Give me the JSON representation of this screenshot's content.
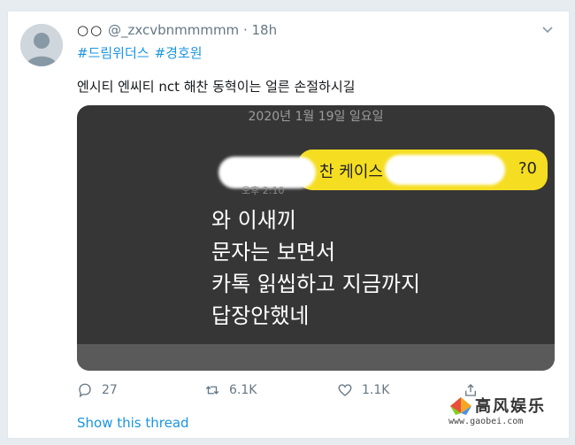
{
  "tweet": {
    "display_name": "○○",
    "handle": "@_zxcvbnmmmmm",
    "separator": "·",
    "time": "18h",
    "hashtags": [
      "#드림위더스",
      "#경호원"
    ],
    "text": "엔시티 엔씨티 nct 해찬 동혁이는 얼른 손절하시길"
  },
  "media": {
    "date_banner": "2020년 1월 19일 일요일",
    "outgoing_fragment_left": "찬 케이스",
    "outgoing_fragment_right": "?0",
    "time_fragment": "오후 2:10",
    "incoming_lines": [
      "와 이새끼",
      "문자는 보면서",
      "카톡 읽씹하고 지금까지",
      "답장안했네"
    ],
    "bubble_color": "#f5de21"
  },
  "actions": {
    "reply_count": "27",
    "retweet_count": "6.1K",
    "like_count": "1.1K"
  },
  "show_thread_label": "Show this thread",
  "watermark": {
    "brand": "高风娱乐",
    "url": "www.gaobei.com"
  },
  "colors": {
    "link": "#1b95e0",
    "muted": "#657786",
    "text": "#14171a"
  }
}
